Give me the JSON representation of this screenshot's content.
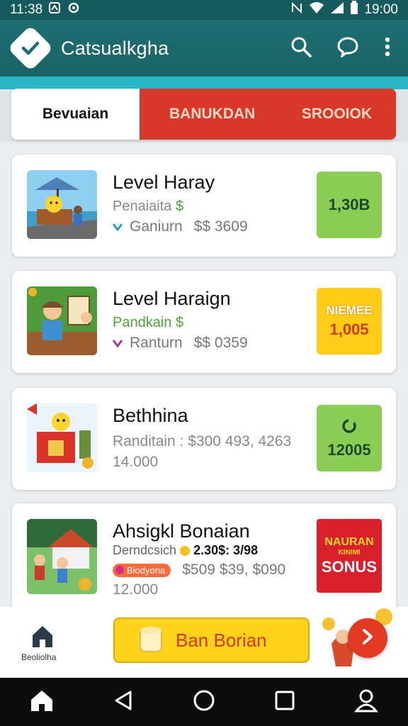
{
  "status_bar": {
    "left_time": "11:38",
    "right_time": "19:00"
  },
  "app": {
    "title": "Catsualkgha"
  },
  "tabs": [
    {
      "label": "Bevuaian"
    },
    {
      "label": "BANUKDAN"
    },
    {
      "label": "SROOIOK"
    }
  ],
  "cards": [
    {
      "title": "Level Haray",
      "subtitle": "Penaiaita",
      "meta_label": "Ganiurn",
      "meta_value": "$$ 3609",
      "badge": "1,30B"
    },
    {
      "title": "Level Haraign",
      "subtitle": "Pandkain",
      "meta_label": "Ranturn",
      "meta_value": "$$ 0359",
      "badge_top": "NIEMEE",
      "badge": "1,005"
    },
    {
      "title": "Bethhina",
      "line1": "Randitain : $300 493, 4263",
      "line2": "14.000",
      "badge": "12005"
    },
    {
      "title": "Ahsigkl Bonaian",
      "subtitle": "Derndcsich",
      "subtitle_value": "2.30$: 3/98",
      "tag": "Biodyona",
      "meta_value": "$509 $39, $090",
      "line2": "12.000",
      "badge_top": "NAURAN",
      "badge_mid": "KINIMI",
      "badge": "SONUS"
    }
  ],
  "bottom": {
    "home_label": "Beoliolha",
    "promo_label": "Ban Borian"
  },
  "colors": {
    "appbar": "#1d6e71",
    "accent_red": "#d8382a",
    "badge_green": "#8ccd55",
    "badge_yellow": "#ffcc17"
  }
}
